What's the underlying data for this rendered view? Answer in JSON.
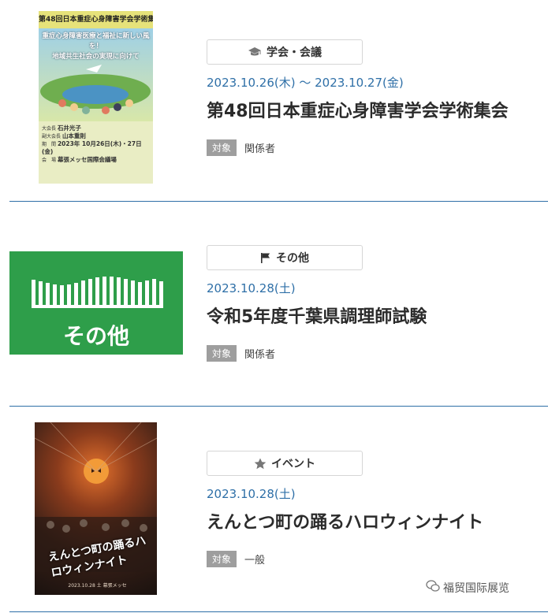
{
  "events": [
    {
      "category": "学会・会議",
      "category_icon": "mortarboard-icon",
      "date": "2023.10.26(木) ～ 2023.10.27(金)",
      "title": "第48回日本重症心身障害学会学術集会",
      "target_label": "対象",
      "target": "関係者",
      "poster": {
        "header": "第48回日本重症心身障害学会学術集会",
        "slogan_line1": "重症心身障害医療と福祉に新しい風を！",
        "slogan_line2": "地域共生社会の実現に向けて",
        "role1": "大会長",
        "name1": "石井光子",
        "role2": "副大会長",
        "name2": "山本重則",
        "period_label": "期　間",
        "period": "2023年 10月26日(木)・27日(金)",
        "venue_label": "会　場",
        "venue": "幕張メッセ国際会議場"
      }
    },
    {
      "category": "その他",
      "category_icon": "flag-icon",
      "date": "2023.10.28(土)",
      "title": "令和5年度千葉県調理師試験",
      "target_label": "対象",
      "target": "関係者",
      "thumb_label": "その他"
    },
    {
      "category": "イベント",
      "category_icon": "star-icon",
      "date": "2023.10.28(土)",
      "title": "えんとつ町の踊るハロウィンナイト",
      "target_label": "対象",
      "target": "一般",
      "poster": {
        "logo": "えんとつ町の踊るハロウィンナイト",
        "sub": "2023.10.28 土 幕張メッセ"
      }
    }
  ],
  "watermark": "福贸国际展览",
  "colors": {
    "accent": "#2e6fa7",
    "other_green": "#2e9e4a",
    "badge_gray": "#9e9e9e"
  }
}
